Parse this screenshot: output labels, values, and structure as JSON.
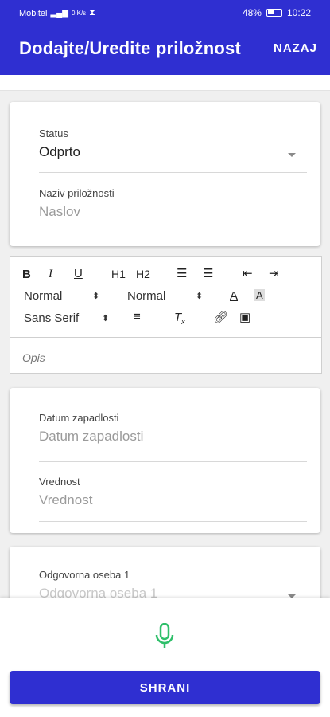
{
  "statusbar": {
    "carrier": "Mobitel",
    "net_speed": "0 K/s",
    "battery": "48%",
    "time": "10:22"
  },
  "appbar": {
    "title": "Dodajte/Uredite priložnost",
    "back_label": "NAZAJ"
  },
  "card1": {
    "status_label": "Status",
    "status_value": "Odprto",
    "name_label": "Naziv priložnosti",
    "name_placeholder": "Naslov"
  },
  "editor": {
    "toolbar": {
      "bold": "B",
      "italic": "I",
      "underline": "U",
      "h1": "H1",
      "h2": "H2",
      "size_select": "Normal",
      "header_select": "Normal",
      "font_select": "Sans Serif"
    },
    "placeholder": "Opis"
  },
  "card2": {
    "due_label": "Datum zapadlosti",
    "due_placeholder": "Datum zapadlosti",
    "value_label": "Vrednost",
    "value_placeholder": "Vrednost"
  },
  "card3": {
    "owner_label": "Odgovorna oseba 1",
    "owner_placeholder": "Odgovorna oseba 1"
  },
  "bottom": {
    "save_label": "SHRANI"
  },
  "colors": {
    "primary": "#2f2fd1",
    "mic": "#2fbf6a"
  }
}
